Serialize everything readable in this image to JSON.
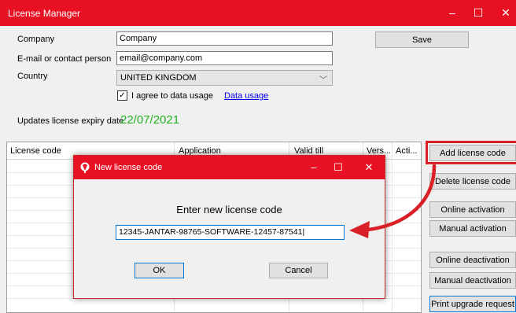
{
  "window": {
    "title": "License Manager",
    "minimize": "–",
    "maximize": "☐",
    "close": "✕"
  },
  "form": {
    "company_label": "Company",
    "company_value": "Company",
    "email_label": "E-mail or contact person",
    "email_value": "email@company.com",
    "country_label": "Country",
    "country_value": "UNITED KINGDOM",
    "agree_label": "I agree to data usage",
    "agree_checked": "✓",
    "data_usage_link": "Data usage",
    "expiry_label": "Updates license expiry date",
    "expiry_value": "22/07/2021",
    "save_label": "Save"
  },
  "grid": {
    "columns": [
      "License code",
      "Application",
      "Valid till",
      "Vers...",
      "Acti..."
    ]
  },
  "actions": {
    "add": "Add license code",
    "delete": "Delete license code",
    "online_activation": "Online activation",
    "manual_activation": "Manual activation",
    "online_deactivation": "Online deactivation",
    "manual_deactivation": "Manual deactivation",
    "print_upgrade": "Print upgrade request"
  },
  "dialog": {
    "title": "New license code",
    "minimize": "–",
    "maximize": "☐",
    "close": "✕",
    "prompt": "Enter new license code",
    "input_value": "12345-JANTAR-98765-SOFTWARE-12457-87541",
    "ok_label": "OK",
    "cancel_label": "Cancel"
  },
  "colors": {
    "titlebar": "#e81123",
    "highlight": "#d92027",
    "expiry": "#22b422",
    "link": "#0000ee"
  }
}
